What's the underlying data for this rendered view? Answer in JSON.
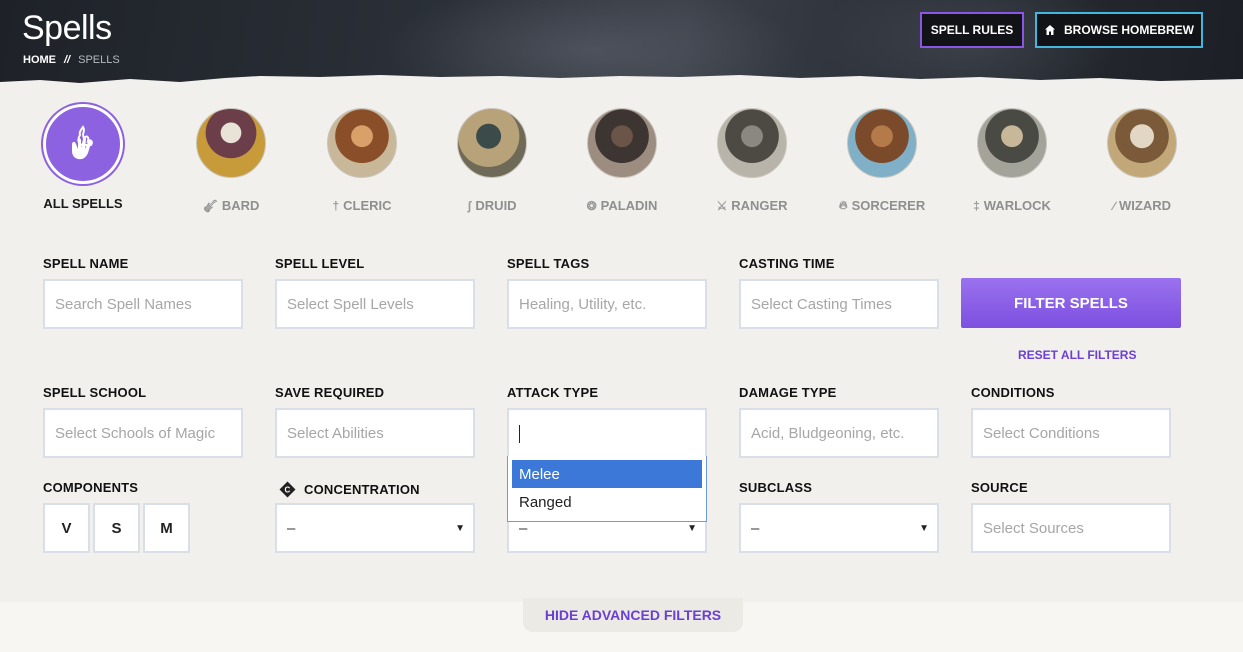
{
  "header": {
    "title": "Spells",
    "breadcrumb_home": "HOME",
    "breadcrumb_sep": "//",
    "breadcrumb_current": "SPELLS",
    "spell_rules_label": "SPELL RULES",
    "browse_homebrew_label": "BROWSE HOMEBREW"
  },
  "classes": {
    "all": "ALL SPELLS",
    "items": [
      "BARD",
      "CLERIC",
      "DRUID",
      "PALADIN",
      "RANGER",
      "SORCERER",
      "WARLOCK",
      "WIZARD"
    ]
  },
  "filters": {
    "spell_name": {
      "label": "SPELL NAME",
      "placeholder": "Search Spell Names"
    },
    "spell_level": {
      "label": "SPELL LEVEL",
      "placeholder": "Select Spell Levels"
    },
    "spell_tags": {
      "label": "SPELL TAGS",
      "placeholder": "Healing, Utility, etc."
    },
    "casting_time": {
      "label": "CASTING TIME",
      "placeholder": "Select Casting Times"
    },
    "filter_button": "FILTER SPELLS",
    "reset_link": "RESET ALL FILTERS",
    "spell_school": {
      "label": "SPELL SCHOOL",
      "placeholder": "Select Schools of Magic"
    },
    "save_required": {
      "label": "SAVE REQUIRED",
      "placeholder": "Select Abilities"
    },
    "attack_type": {
      "label": "ATTACK TYPE",
      "value": "",
      "options": [
        "Melee",
        "Ranged"
      ],
      "highlighted": "Melee"
    },
    "damage_type": {
      "label": "DAMAGE TYPE",
      "placeholder": "Acid, Bludgeoning, etc."
    },
    "conditions": {
      "label": "CONDITIONS",
      "placeholder": "Select Conditions"
    },
    "components": {
      "label": "COMPONENTS",
      "v": "V",
      "s": "S",
      "m": "M"
    },
    "concentration": {
      "label": "CONCENTRATION",
      "value": "–"
    },
    "ritual": {
      "value": "–"
    },
    "subclass": {
      "label": "SUBCLASS",
      "value": "–"
    },
    "source": {
      "label": "SOURCE",
      "placeholder": "Select Sources"
    }
  },
  "hide_advanced": "HIDE ADVANCED FILTERS",
  "colors": {
    "accent": "#8c62e0",
    "link": "#6c3fd4",
    "dropdown_highlight": "#3b78d8"
  }
}
